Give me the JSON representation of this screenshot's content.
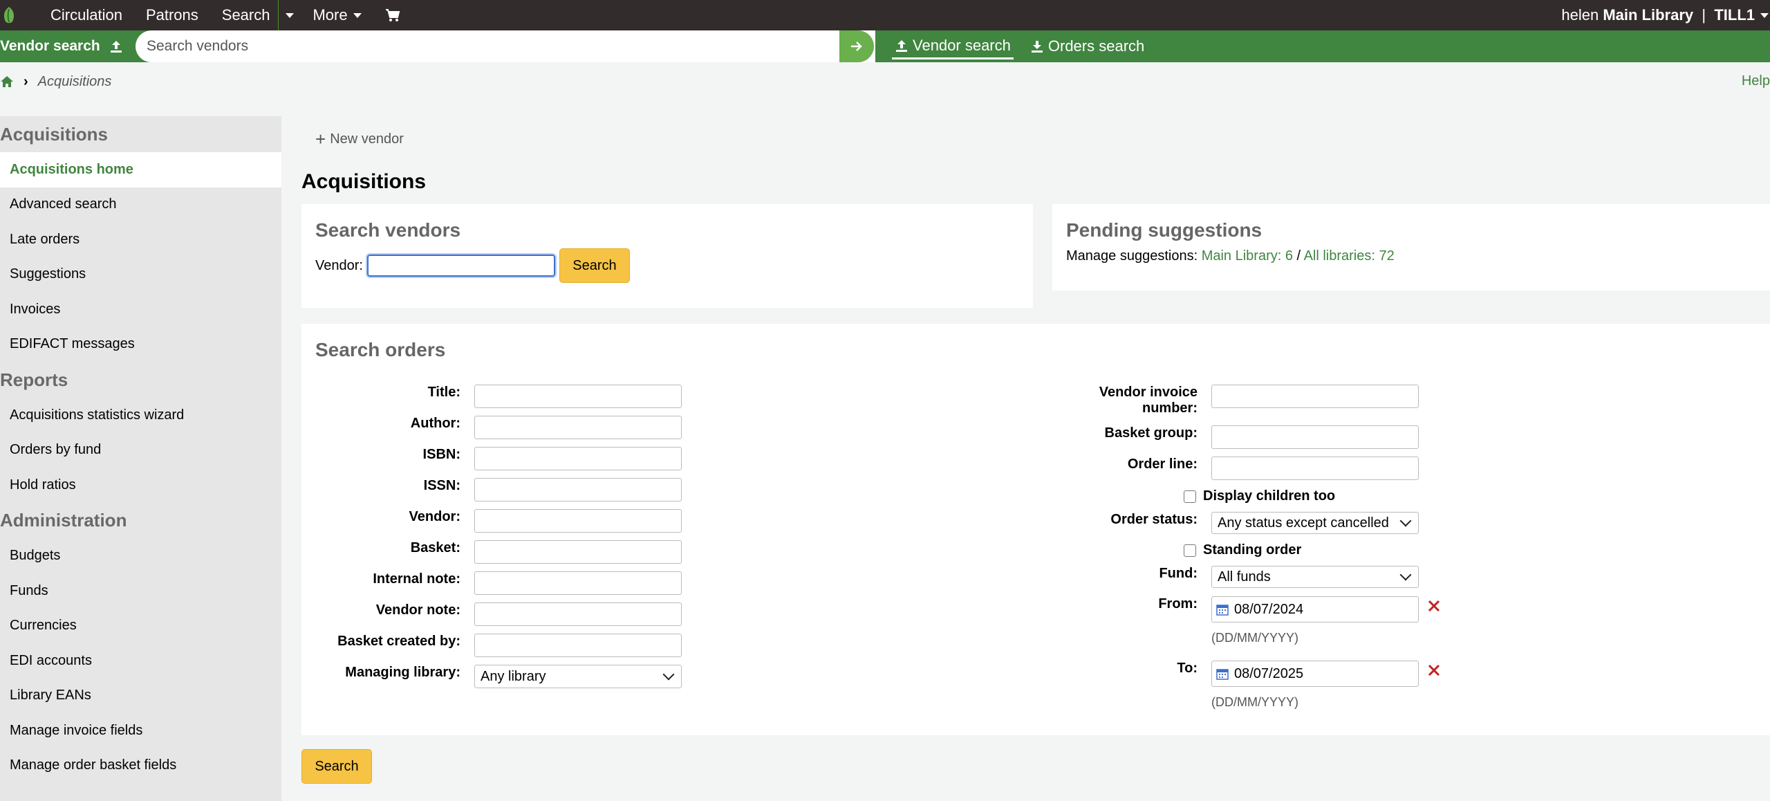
{
  "topbar": {
    "nav": [
      "Circulation",
      "Patrons",
      "Search",
      "More"
    ],
    "user": "helen",
    "library": "Main Library",
    "separator": "|",
    "register": "TILL1"
  },
  "searchbar": {
    "label": "Vendor search",
    "placeholder": "Search vendors",
    "tabs": [
      "Vendor search",
      "Orders search"
    ]
  },
  "breadcrumb": {
    "current": "Acquisitions",
    "help": "Help"
  },
  "sidebar": {
    "sections": [
      {
        "heading": "Acquisitions",
        "items": [
          "Acquisitions home",
          "Advanced search",
          "Late orders",
          "Suggestions",
          "Invoices",
          "EDIFACT messages"
        ]
      },
      {
        "heading": "Reports",
        "items": [
          "Acquisitions statistics wizard",
          "Orders by fund",
          "Hold ratios"
        ]
      },
      {
        "heading": "Administration",
        "items": [
          "Budgets",
          "Funds",
          "Currencies",
          "EDI accounts",
          "Library EANs",
          "Manage invoice fields",
          "Manage order basket fields"
        ]
      }
    ]
  },
  "main": {
    "new_vendor": "New vendor",
    "title": "Acquisitions",
    "vendor_panel": {
      "title": "Search vendors",
      "vendor_label": "Vendor:",
      "search_button": "Search"
    },
    "suggestions_panel": {
      "title": "Pending suggestions",
      "prefix": "Manage suggestions:",
      "main_library_link": "Main Library: 6",
      "slash": "/",
      "all_libraries_link": "All libraries: 72"
    },
    "orders_panel": {
      "title": "Search orders",
      "left_fields": [
        "Title:",
        "Author:",
        "ISBN:",
        "ISSN:",
        "Vendor:",
        "Basket:",
        "Internal note:",
        "Vendor note:",
        "Basket created by:"
      ],
      "managing_library_label": "Managing library:",
      "managing_library_value": "Any library",
      "vendor_invoice_label_1": "Vendor invoice",
      "vendor_invoice_label_2": "number:",
      "basket_group_label": "Basket group:",
      "order_line_label": "Order line:",
      "display_children": "Display children too",
      "order_status_label": "Order status:",
      "order_status_value": "Any status except cancelled",
      "standing_order": "Standing order",
      "fund_label": "Fund:",
      "fund_value": "All funds",
      "from_label": "From:",
      "from_value": "08/07/2024",
      "to_label": "To:",
      "to_value": "08/07/2025",
      "date_hint": "(DD/MM/YYYY)",
      "search_button": "Search"
    }
  },
  "colors": {
    "topbar": "#332c2c",
    "accent_green": "#408540",
    "button_yellow": "#f6c344",
    "clear_red": "#c32020"
  }
}
